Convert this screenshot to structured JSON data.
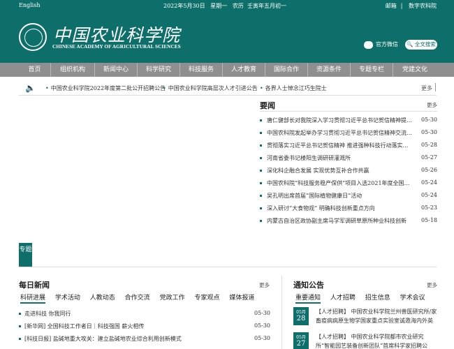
{
  "topbar": {
    "language": "English",
    "date": "2022年5月30日",
    "weekday": "星期一",
    "lunar_label": "农历",
    "lunar_date": "壬寅年五月初一",
    "links": [
      "邮箱",
      "数字农科院"
    ]
  },
  "header": {
    "logo_cn": "中国农业科学院",
    "logo_en": "CHINESE ACADEMY OF AGRICULTURAL SCIENCES",
    "wechat_label": "官方微信",
    "search_label": "全文搜索"
  },
  "nav": [
    "首页",
    "组织机构",
    "新闻中心",
    "科学研究",
    "科技服务",
    "人才教育",
    "国际合作",
    "资源条件",
    "专题专栏",
    "党建文化"
  ],
  "ticker": {
    "items": [
      "中国农业科学院2022年度第二批公开招聘公告",
      "中国农业科学院高层次人才引进公告",
      "各界人士悼念江巧生院士"
    ],
    "more": "更多"
  },
  "headlines": {
    "title": "要闻",
    "more": "更多",
    "items": [
      {
        "title": "唐仁健部长对我院深入学习贯彻习近平总书记贺信精神提…",
        "date": "05-30"
      },
      {
        "title": "中国农科院发起举办学习贯彻习近平总书记贺信精神交流…",
        "date": "05-30"
      },
      {
        "title": "贯彻落实习近平总书记贺信精神 推进强种科技行动落实落…",
        "date": "05-28"
      },
      {
        "title": "河南省委书记楼阳生调研研灌溉所",
        "date": "05-27"
      },
      {
        "title": "深化科企融合发展 实现优势互补合作共赢",
        "date": "05-26"
      },
      {
        "title": "中国农科院“科技服务稳产保供”项目入选2021年度全国学…",
        "date": "05-24"
      },
      {
        "title": "吴孔明出席首届“国际植物健康日”活动",
        "date": "05-24"
      },
      {
        "title": "深入研讨“大食物观” 明确科技创新重点方向",
        "date": "05-23"
      },
      {
        "title": "内蒙古自治区政协副主席马学军调研草原所种业科技创新",
        "date": "05-18"
      }
    ]
  },
  "zhuanti": "专题",
  "daily_news": {
    "title": "每日新闻",
    "more": "更多",
    "tabs": [
      "科研进展",
      "学术活动",
      "人教动态",
      "合作交流",
      "党政工作",
      "专家观点",
      "媒体报道"
    ],
    "items": [
      {
        "title": "走进科技 你我同行",
        "date": "05-30"
      },
      {
        "title": "[新华网] 全国科技工作者日｜科技强国 薪火相传",
        "date": "05-30"
      },
      {
        "title": "[科技日报] 盐碱地重大攻关：建立盐碱地农业综合利用创新模式",
        "date": "05-30"
      }
    ]
  },
  "notices": {
    "title": "通知公告",
    "more": "更多",
    "tabs": [
      "重要通知",
      "人才招聘",
      "招生信息",
      "学术会议"
    ],
    "items": [
      {
        "month": "05月",
        "day": "28日",
        "text": "【人才招聘】 中国农业科学院兰州兽医研究所/家畜疫病病原生物学国家重点实验室诚邀海内外英"
      },
      {
        "month": "05月",
        "day": "27日",
        "text": "【人才招聘】 中国农业科学院都市农业研究所“智能园艺装备创新团队”首席科学家招聘公"
      }
    ]
  },
  "colors": {
    "primary": "#0e6f6a",
    "nav_bg": "#8f8f8f"
  }
}
